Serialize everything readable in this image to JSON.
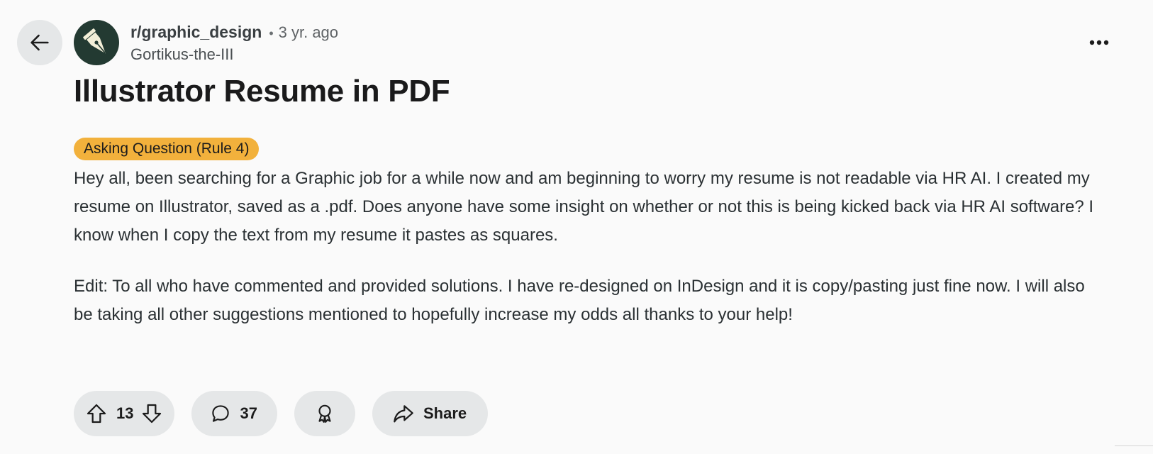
{
  "post": {
    "subreddit": "r/graphic_design",
    "separator": "•",
    "age": "3 yr. ago",
    "author": "Gortikus-the-III",
    "title": "Illustrator Resume in PDF",
    "flair": {
      "label": "Asking Question (Rule 4)",
      "color": "#f2b13c"
    },
    "body": [
      "Hey all, been searching for a Graphic job for a while now and am beginning to worry my resume is not readable via HR AI. I created my resume on Illustrator, saved as a .pdf. Does anyone have some insight on whether or not this is being kicked back via HR AI software? I know when I copy the text from my resume it pastes as squares.",
      "Edit: To all who have commented and provided solutions. I have re-designed on InDesign and it is copy/pasting just fine now. I will also be taking all other suggestions mentioned to hopefully increase my odds all thanks to your help!"
    ]
  },
  "actions": {
    "score": "13",
    "comments": "37",
    "share_label": "Share"
  },
  "icons": {
    "back": "arrow-left-icon",
    "avatar": "pen-nib-icon",
    "more": "ellipsis-icon",
    "upvote": "arrow-up-icon",
    "downvote": "arrow-down-icon",
    "comment": "speech-bubble-icon",
    "award": "award-ribbon-icon",
    "share": "share-arrow-icon"
  },
  "colors": {
    "background": "#fafafa",
    "button": "#e5e7e8",
    "avatar": "#233a32",
    "flair": "#f2b13c"
  }
}
